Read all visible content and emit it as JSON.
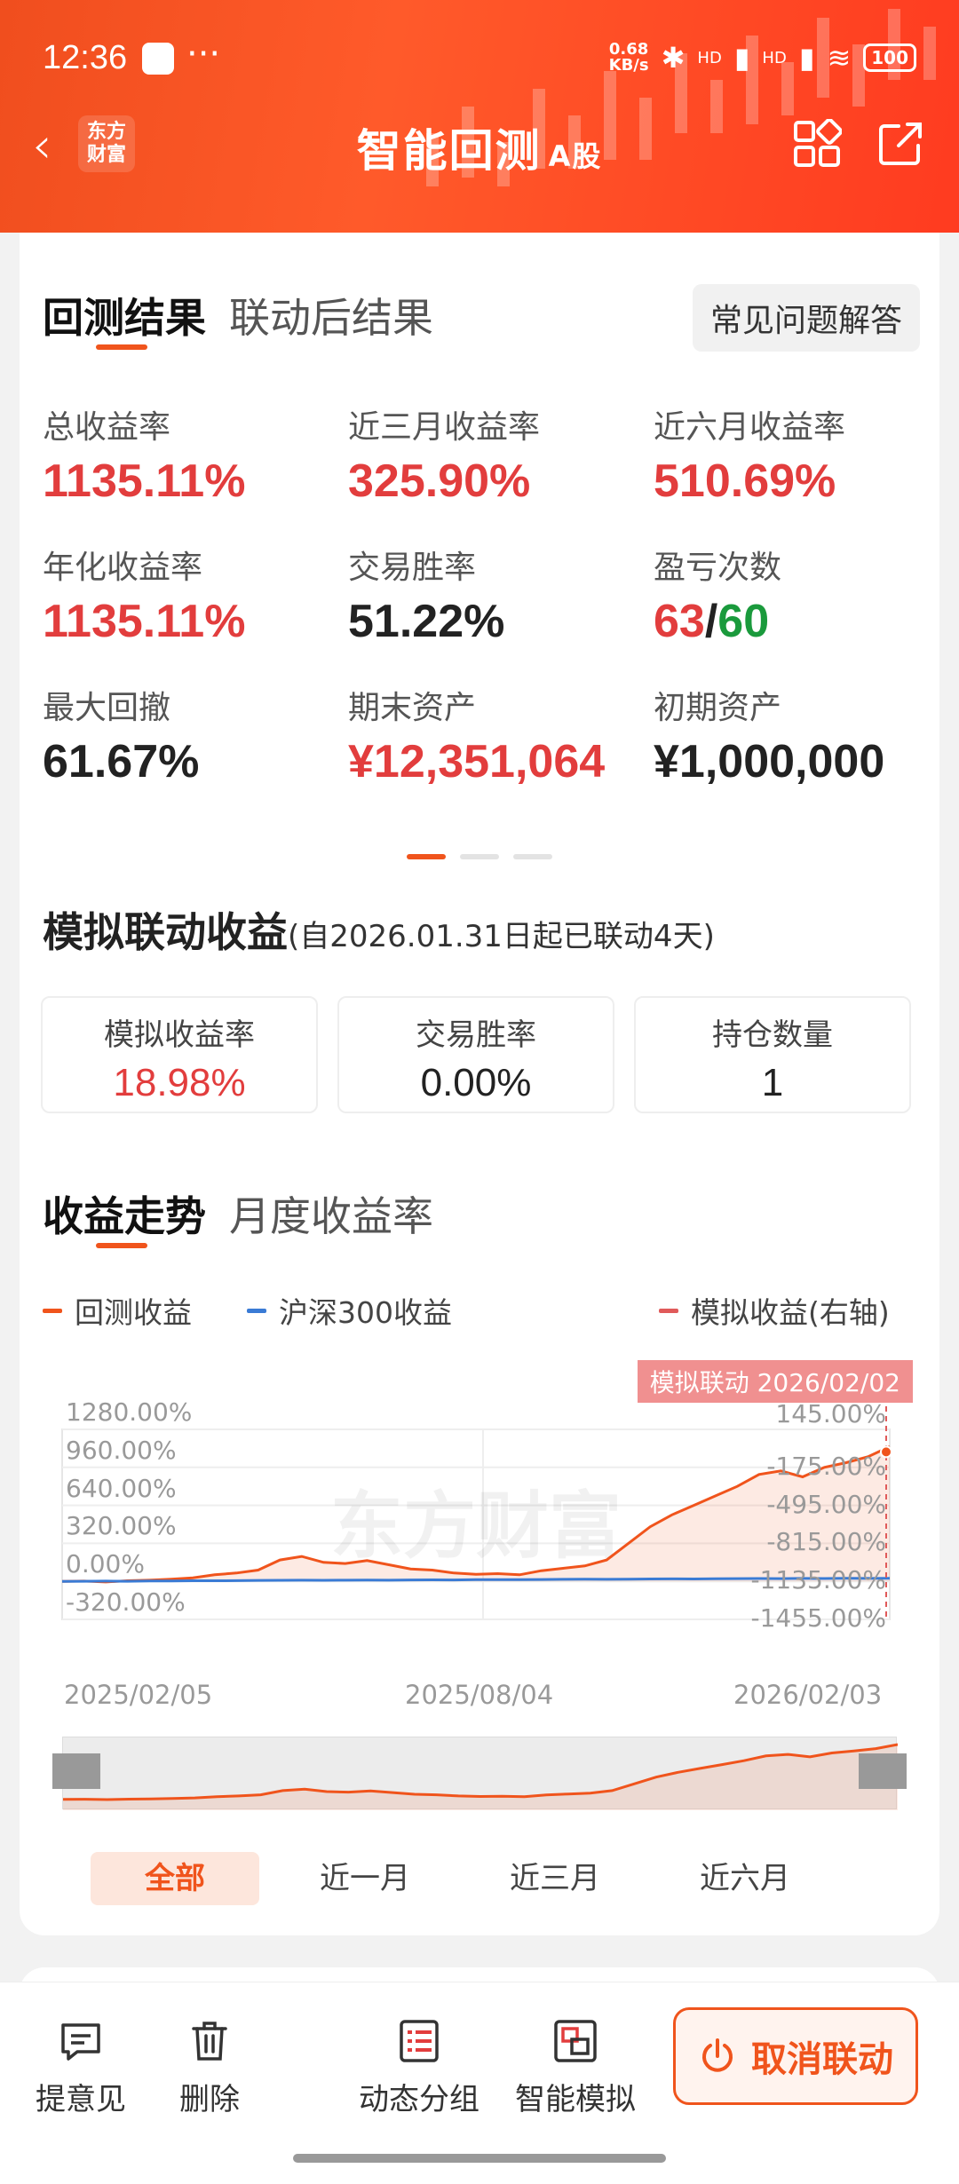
{
  "status_bar": {
    "time": "12:36",
    "more": "···",
    "speed_value": "0.68",
    "speed_unit": "KB/s",
    "signal1": "HD",
    "signal2": "HD",
    "battery": "100"
  },
  "nav": {
    "back": "‹",
    "logo_line1": "东方",
    "logo_line2": "财富",
    "title": "智能回测",
    "title_sub": "A股"
  },
  "result_tabs": [
    "回测结果",
    "联动后结果"
  ],
  "faq_label": "常见问题解答",
  "metrics": [
    {
      "label": "总收益率",
      "value": "1135.11%",
      "color": "red"
    },
    {
      "label": "近三月收益率",
      "value": "325.90%",
      "color": "red"
    },
    {
      "label": "近六月收益率",
      "value": "510.69%",
      "color": "red"
    },
    {
      "label": "年化收益率",
      "value": "1135.11%",
      "color": "red"
    },
    {
      "label": "交易胜率",
      "value": "51.22%",
      "color": "dark"
    },
    {
      "label": "盈亏次数",
      "value_win": "63",
      "value_sep": "/",
      "value_loss": "60"
    },
    {
      "label": "最大回撤",
      "value": "61.67%",
      "color": "dark"
    },
    {
      "label": "期末资产",
      "value": "¥12,351,064",
      "color": "red"
    },
    {
      "label": "初期资产",
      "value": "¥1,000,000",
      "color": "dark"
    }
  ],
  "simulation": {
    "title": "模拟联动收益",
    "note": "(自2026.01.31日起已联动4天)",
    "boxes": [
      {
        "label": "模拟收益率",
        "value": "18.98%",
        "color": "red"
      },
      {
        "label": "交易胜率",
        "value": "0.00%",
        "color": "dark"
      },
      {
        "label": "持仓数量",
        "value": "1",
        "color": "dark"
      }
    ]
  },
  "trend_tabs": [
    "收益走势",
    "月度收益率"
  ],
  "legend": [
    {
      "label": "回测收益",
      "color": "#f0541c"
    },
    {
      "label": "沪深300收益",
      "color": "#3a7bd5"
    },
    {
      "label": "模拟收益(右轴)",
      "color": "#e05a5a"
    }
  ],
  "chart_data": {
    "type": "line",
    "marker_label": "模拟联动 2026/02/02",
    "y_left_ticks": [
      "1280.00%",
      "960.00%",
      "640.00%",
      "320.00%",
      "0.00%",
      "-320.00%"
    ],
    "y_right_ticks": [
      "145.00%",
      "-175.00%",
      "-495.00%",
      "-815.00%",
      "-1135.00%",
      "-1455.00%"
    ],
    "x_ticks": [
      "2025/02/05",
      "2025/08/04",
      "2026/02/03"
    ],
    "ylim_left": [
      -320,
      1280
    ],
    "ylim_right": [
      -1455,
      145
    ],
    "watermark": "东方财富",
    "series": [
      {
        "name": "回测收益",
        "color": "#f0541c",
        "values": [
          0,
          2,
          -5,
          5,
          10,
          18,
          30,
          55,
          70,
          95,
          180,
          210,
          160,
          150,
          175,
          140,
          105,
          95,
          70,
          60,
          65,
          55,
          90,
          110,
          130,
          180,
          320,
          460,
          560,
          640,
          720,
          800,
          900,
          930,
          880,
          960,
          1000,
          1050,
          1135
        ]
      },
      {
        "name": "沪深300收益",
        "color": "#3a7bd5",
        "values": [
          0,
          1,
          2,
          1,
          3,
          4,
          5,
          5,
          6,
          8,
          9,
          10,
          9,
          10,
          11,
          10,
          12,
          13,
          12,
          14,
          15,
          14,
          16,
          17,
          18,
          17,
          19,
          20,
          21,
          20,
          22,
          23,
          24,
          23,
          25,
          24,
          26,
          25,
          26
        ]
      }
    ]
  },
  "ranges": [
    "全部",
    "近一月",
    "近三月",
    "近六月"
  ],
  "bottom_actions": [
    "提意见",
    "删除",
    "动态分组",
    "智能模拟"
  ],
  "cancel_label": "取消联动"
}
